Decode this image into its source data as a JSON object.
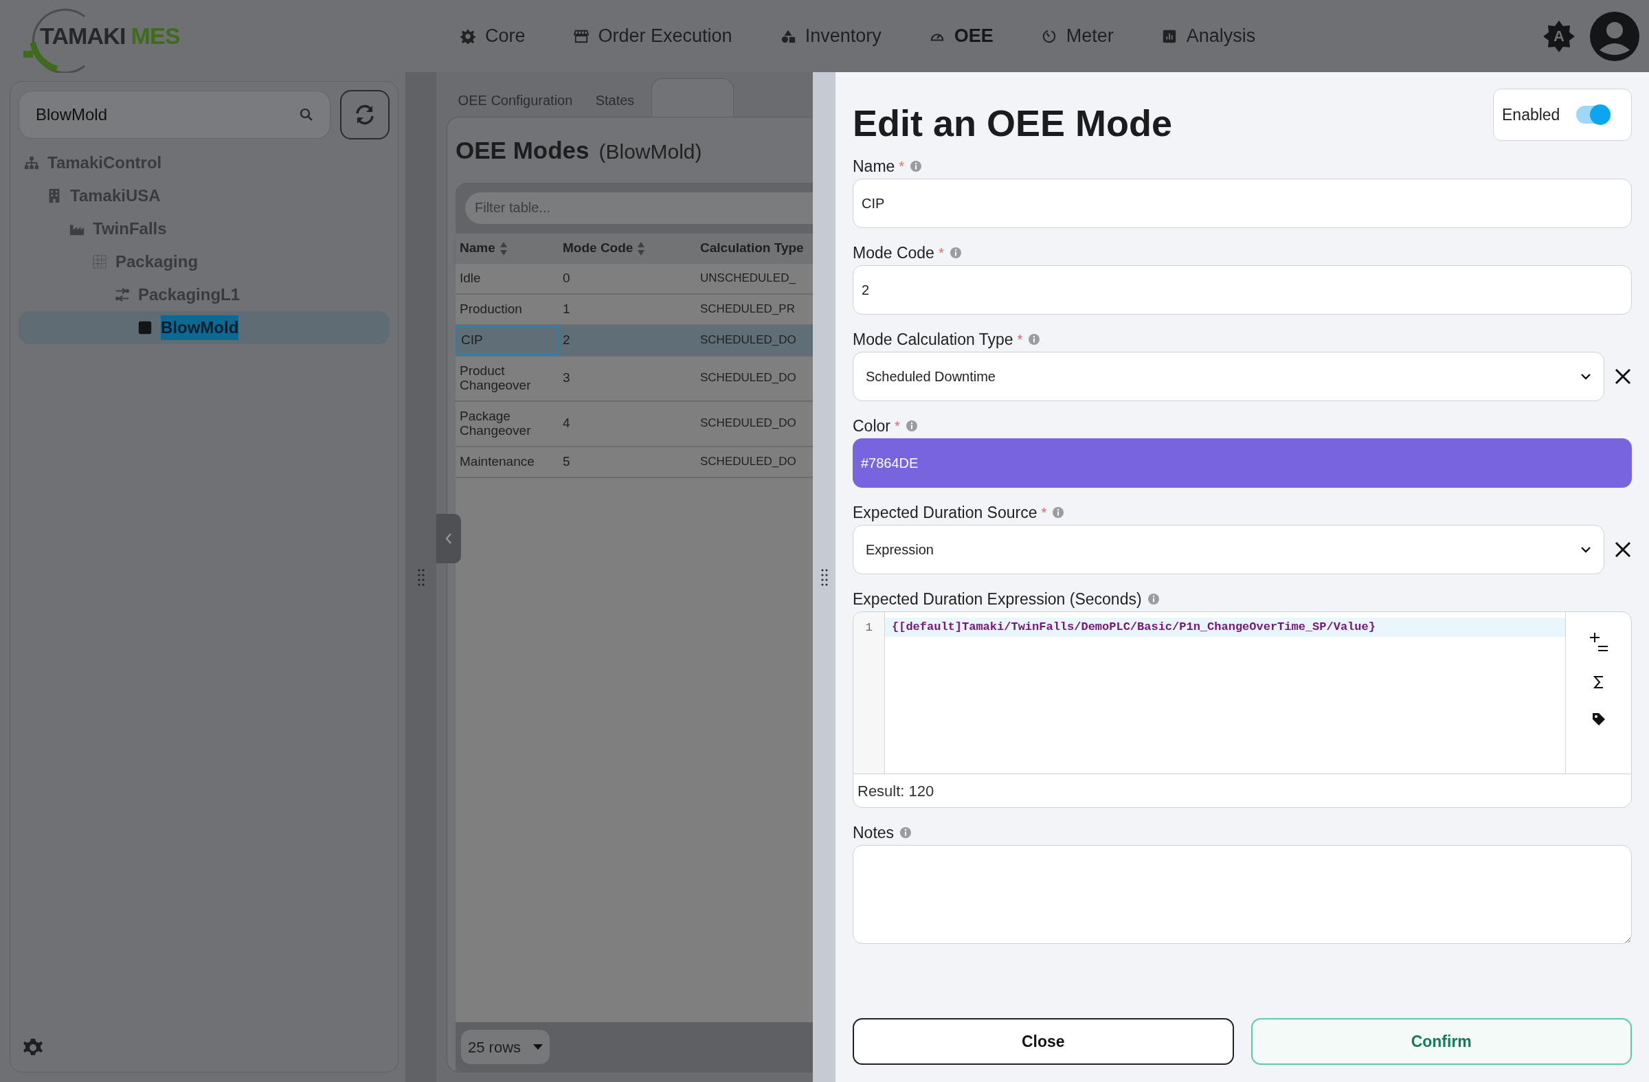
{
  "logo": {
    "word1": "TAMAKI",
    "word2": "MES"
  },
  "nav": [
    {
      "label": "Core",
      "selected": false
    },
    {
      "label": "Order Execution",
      "selected": false
    },
    {
      "label": "Inventory",
      "selected": false
    },
    {
      "label": "OEE",
      "selected": true
    },
    {
      "label": "Meter",
      "selected": false
    },
    {
      "label": "Analysis",
      "selected": false
    }
  ],
  "theme_toggle": {
    "label": "A"
  },
  "sidebar": {
    "search": {
      "value": "BlowMold"
    },
    "tree": [
      {
        "label": "TamakiControl",
        "selected": false,
        "children": [
          {
            "label": "TamakiUSA",
            "selected": false,
            "children": [
              {
                "label": "TwinFalls",
                "selected": false,
                "children": [
                  {
                    "label": "Packaging",
                    "selected": false,
                    "children": [
                      {
                        "label": "PackagingL1",
                        "selected": false,
                        "children": [
                          {
                            "label": "BlowMold",
                            "selected": true
                          }
                        ]
                      }
                    ]
                  }
                ]
              }
            ]
          }
        ]
      }
    ]
  },
  "tabs": [
    {
      "label": "OEE Configuration",
      "selected": false
    },
    {
      "label": "States",
      "selected": false
    }
  ],
  "modes": {
    "title": "OEE Modes",
    "subtitle": "(BlowMold)",
    "filter": {
      "placeholder": "Filter table..."
    },
    "columns": [
      {
        "label": "Name",
        "sortable": true
      },
      {
        "label": "Mode Code",
        "sortable": true
      },
      {
        "label": "Calculation Type"
      }
    ],
    "rows": [
      {
        "cells": [
          "Idle",
          "0",
          "UNSCHEDULED_"
        ],
        "selected": false
      },
      {
        "cells": [
          "Production",
          "1",
          "SCHEDULED_PR"
        ],
        "selected": false
      },
      {
        "cells": [
          "CIP",
          "2",
          "SCHEDULED_DO"
        ],
        "selected": true
      },
      {
        "cells": [
          "Product Changeover",
          "3",
          "SCHEDULED_DO"
        ],
        "selected": false
      },
      {
        "cells": [
          "Package Changeover",
          "4",
          "SCHEDULED_DO"
        ],
        "selected": false
      },
      {
        "cells": [
          "Maintenance",
          "5",
          "SCHEDULED_DO"
        ],
        "selected": false
      }
    ],
    "page_size": "25 rows"
  },
  "drawer": {
    "title": "Edit an OEE Mode",
    "enabled": {
      "label": "Enabled",
      "on": true
    },
    "fields": [
      {
        "kind": "text",
        "label": "Name",
        "required_mark": "*",
        "value": "CIP"
      },
      {
        "kind": "text",
        "label": "Mode Code",
        "required_mark": "*",
        "value": "2"
      },
      {
        "kind": "select",
        "label": "Mode Calculation Type",
        "required_mark": "*",
        "value": "Scheduled Downtime"
      },
      {
        "kind": "color",
        "label": "Color",
        "required_mark": "*",
        "value": "#7864DE",
        "color": "#7864de"
      },
      {
        "kind": "select",
        "label": "Expected Duration Source",
        "required_mark": "*",
        "value": "Expression"
      },
      {
        "kind": "expression",
        "label": "Expected Duration Expression (Seconds)",
        "line_number": "1",
        "value": "{[default]Tamaki/TwinFalls/DemoPLC/Basic/P1n_ChangeOverTime_SP/Value}",
        "result": "Result: 120"
      },
      {
        "kind": "textarea",
        "label": "Notes"
      }
    ],
    "buttons": [
      {
        "label": "Close",
        "kind": "secondary"
      },
      {
        "label": "Confirm",
        "kind": "primary"
      }
    ]
  }
}
